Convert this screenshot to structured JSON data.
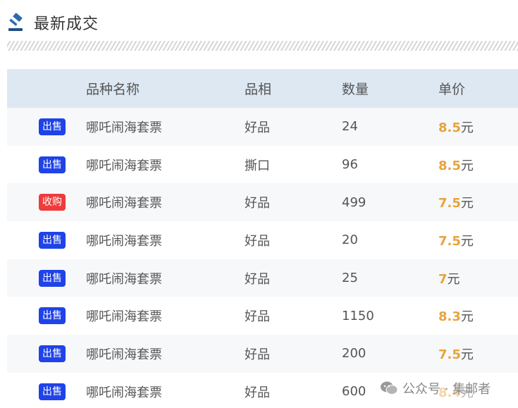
{
  "section": {
    "title": "最新成交",
    "icon": "gavel-icon"
  },
  "colors": {
    "sell_badge": "#1f43e8",
    "buy_badge": "#ee3b3b",
    "price_accent": "#e8a33b",
    "header_bg": "#dde8f3"
  },
  "table": {
    "headers": [
      "品种名称",
      "品相",
      "数量",
      "单价"
    ],
    "rows": [
      {
        "type": "出售",
        "name": "哪吒闹海套票",
        "condition": "好品",
        "quantity": "24",
        "price": "8.5",
        "unit": "元"
      },
      {
        "type": "出售",
        "name": "哪吒闹海套票",
        "condition": "撕口",
        "quantity": "96",
        "price": "8.5",
        "unit": "元"
      },
      {
        "type": "收购",
        "name": "哪吒闹海套票",
        "condition": "好品",
        "quantity": "499",
        "price": "7.5",
        "unit": "元"
      },
      {
        "type": "出售",
        "name": "哪吒闹海套票",
        "condition": "好品",
        "quantity": "20",
        "price": "7.5",
        "unit": "元"
      },
      {
        "type": "出售",
        "name": "哪吒闹海套票",
        "condition": "好品",
        "quantity": "25",
        "price": "7",
        "unit": "元"
      },
      {
        "type": "出售",
        "name": "哪吒闹海套票",
        "condition": "好品",
        "quantity": "1150",
        "price": "8.3",
        "unit": "元"
      },
      {
        "type": "出售",
        "name": "哪吒闹海套票",
        "condition": "好品",
        "quantity": "200",
        "price": "7.5",
        "unit": "元"
      },
      {
        "type": "出售",
        "name": "哪吒闹海套票",
        "condition": "好品",
        "quantity": "600",
        "price": "8.4",
        "unit": "元"
      }
    ]
  },
  "watermark": {
    "text": "公众号 · 集邮者",
    "icon": "wechat-icon"
  }
}
